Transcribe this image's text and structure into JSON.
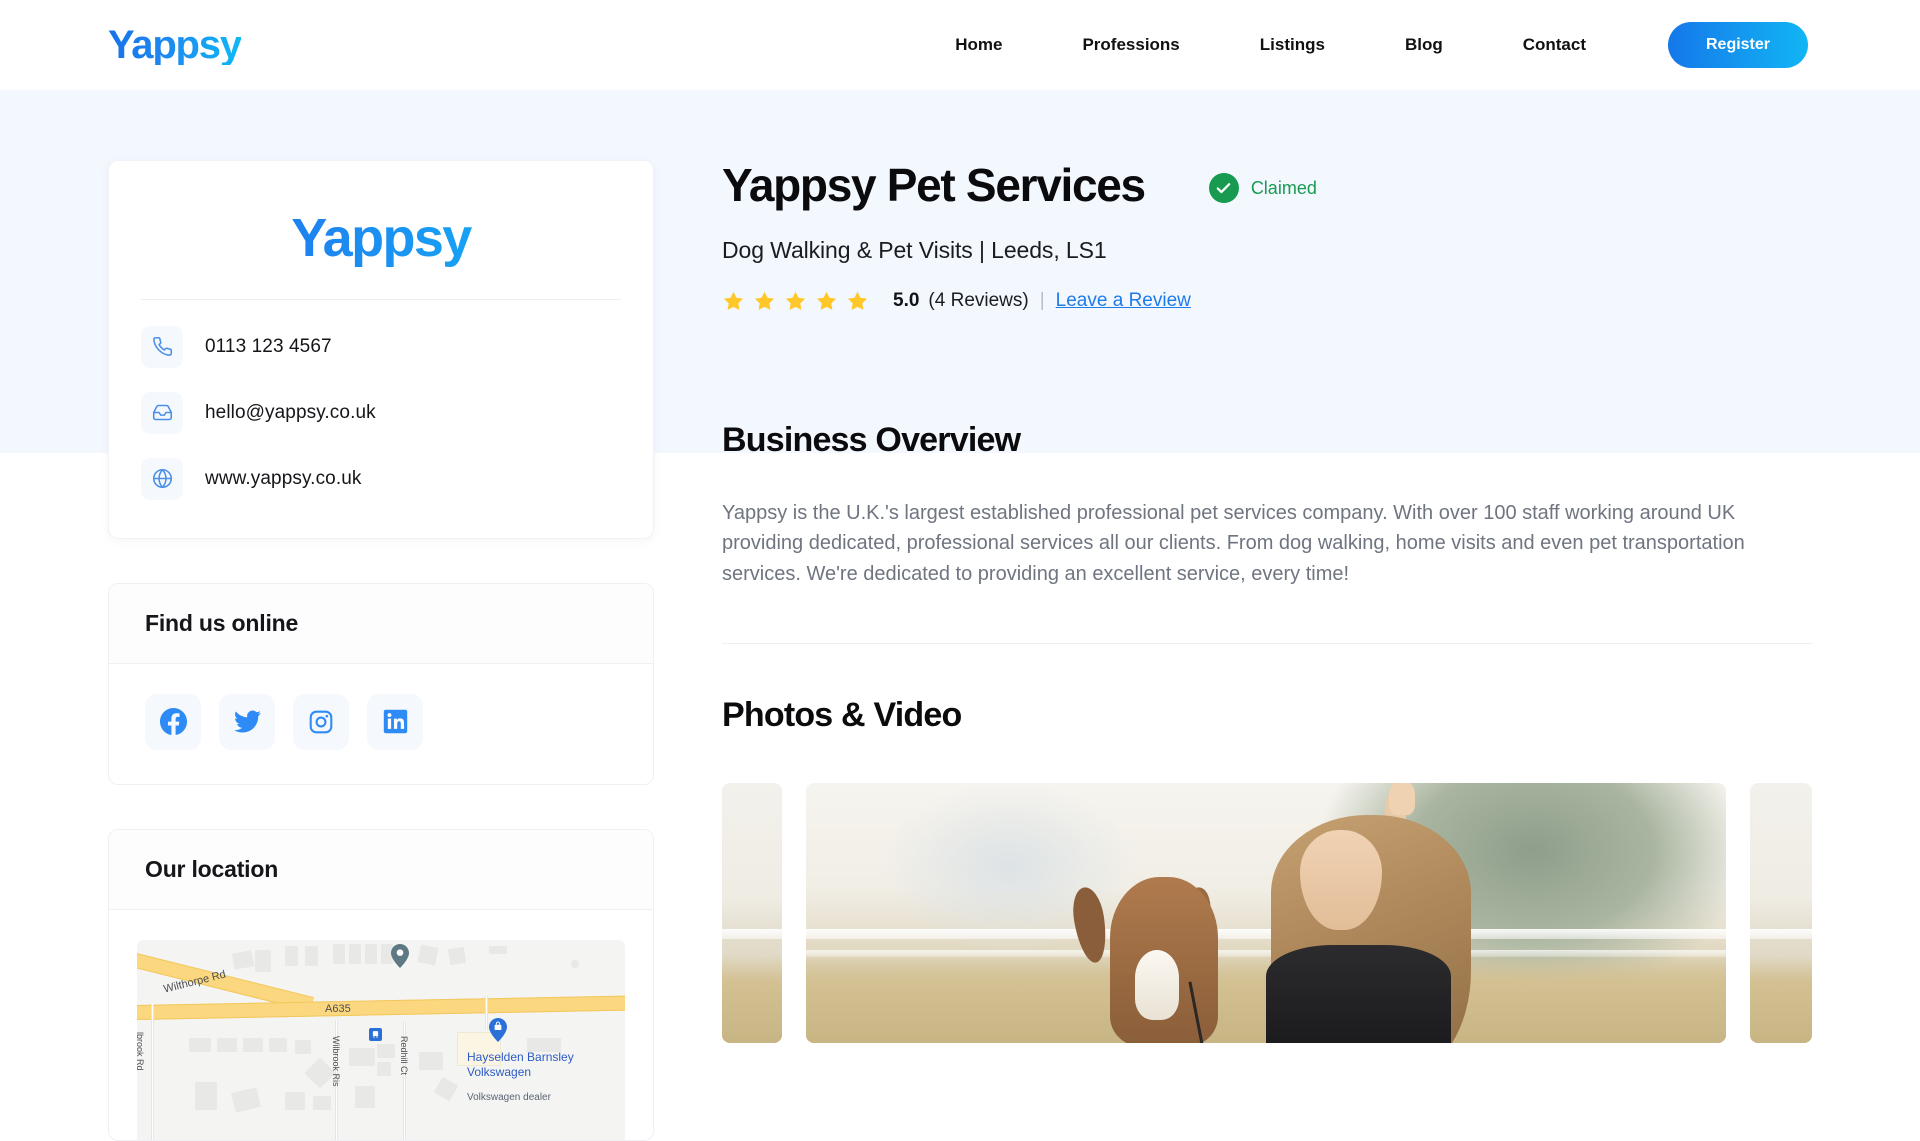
{
  "header": {
    "logo_text": "Yappsy",
    "nav_items": [
      {
        "label": "Home"
      },
      {
        "label": "Professions"
      },
      {
        "label": "Listings"
      },
      {
        "label": "Blog"
      },
      {
        "label": "Contact"
      }
    ],
    "register_label": "Register"
  },
  "contact_card": {
    "logo_text": "Yappsy",
    "phone": "0113 123 4567",
    "email": "hello@yappsy.co.uk",
    "website": "www.yappsy.co.uk"
  },
  "social_panel": {
    "title": "Find us online",
    "networks": [
      {
        "name": "facebook"
      },
      {
        "name": "twitter"
      },
      {
        "name": "instagram"
      },
      {
        "name": "linkedin"
      }
    ]
  },
  "location_panel": {
    "title": "Our location",
    "map": {
      "road_main_label": "A635",
      "road_diagonal_label": "Wilthorpe Rd",
      "vertical_road_labels": [
        "Wilbrook Ris",
        "Redhill Ct",
        "lbrook Rd"
      ],
      "poi_name": "Hayselden Barnsley Volkswagen",
      "poi_category": "Volkswagen dealer"
    }
  },
  "business": {
    "title": "Yappsy Pet Services",
    "claimed_label": "Claimed",
    "subtitle": "Dog Walking & Pet Visits | Leeds, LS1",
    "rating_score": "5.0",
    "rating_count": "(4 Reviews)",
    "rating_separator": "|",
    "leave_review_label": "Leave a Review",
    "stars_filled": 5
  },
  "overview": {
    "heading": "Business Overview",
    "body": "Yappsy is the U.K.'s largest established professional pet services company. With over 100 staff working around UK providing dedicated, professional services all our clients. From dog walking, home visits and even pet transportation services. We're dedicated to providing an excellent service, every time!"
  },
  "photos": {
    "heading": "Photos & Video"
  },
  "colors": {
    "brand_blue": "#1578EA",
    "brand_cyan": "#12B5F4",
    "claimed_green": "#189B51",
    "star_gold": "#FFC828",
    "link_blue": "#1E7BEB",
    "hero_bg": "#F3F7FE",
    "body_text": "#6F7580"
  }
}
